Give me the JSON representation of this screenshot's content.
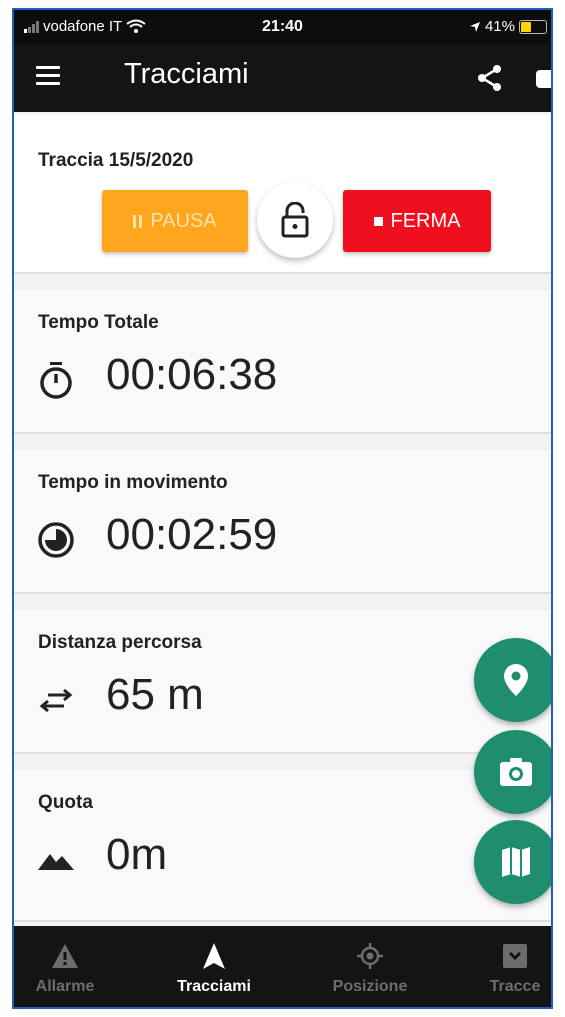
{
  "status_bar": {
    "carrier": "vodafone IT",
    "time": "21:40",
    "battery_text": "41%",
    "battery_level": 0.41
  },
  "app_bar": {
    "title": "Tracciami"
  },
  "track": {
    "title": "Traccia 15/5/2020",
    "pause_label": "PAUSA",
    "stop_label": "FERMA"
  },
  "stats": {
    "total_time": {
      "label": "Tempo Totale",
      "value": "00:06:38"
    },
    "moving_time": {
      "label": "Tempo in movimento",
      "value": "00:02:59"
    },
    "distance": {
      "label": "Distanza percorsa",
      "value": "65 m"
    },
    "altitude": {
      "label": "Quota",
      "value": "0m"
    }
  },
  "bottom_nav": [
    {
      "label": "Allarme",
      "icon": "warning-icon",
      "active": false
    },
    {
      "label": "Tracciami",
      "icon": "navigation-arrow-icon",
      "active": true
    },
    {
      "label": "Posizione",
      "icon": "gps-target-icon",
      "active": false
    },
    {
      "label": "Tracce",
      "icon": "track-list-icon",
      "active": false
    }
  ],
  "colors": {
    "pause": "#ffa51e",
    "stop": "#f00f1e",
    "fab": "#1e8e6e",
    "bars": "#141414"
  }
}
